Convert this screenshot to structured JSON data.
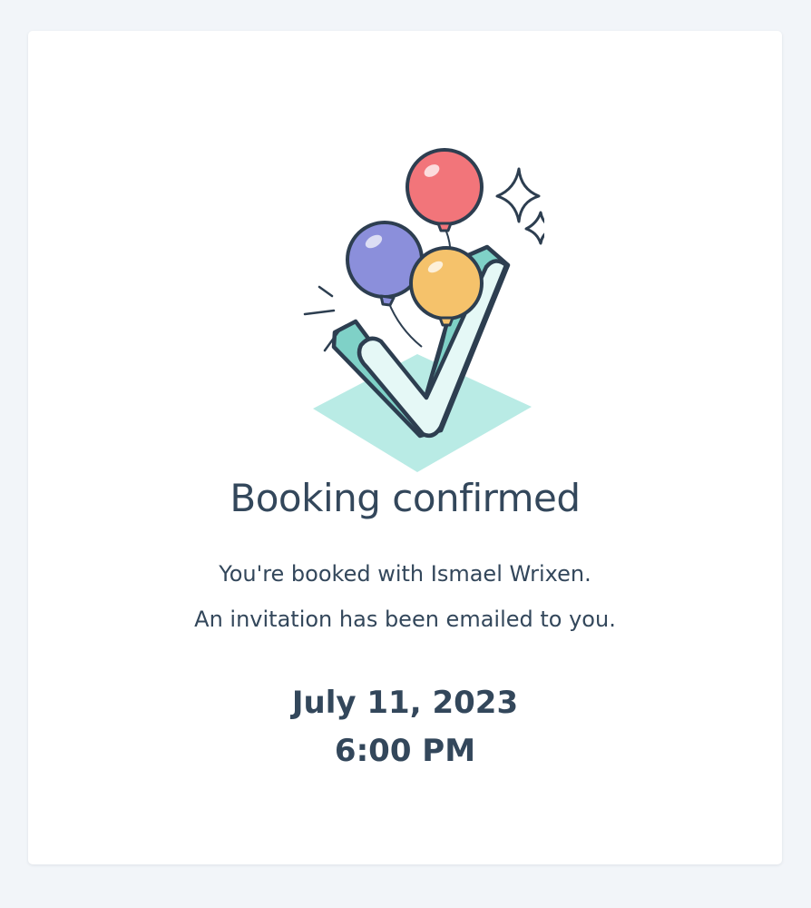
{
  "confirmation": {
    "title": "Booking confirmed",
    "line1": "You're booked with Ismael Wrixen.",
    "line2": "An invitation has been emailed to you.",
    "date": "July 11, 2023",
    "time": "6:00 PM"
  },
  "illustration": {
    "icon": "booking-confirmed-checkmark-balloons-icon",
    "colors": {
      "outline": "#2d3e50",
      "check_face": "#e5f8f6",
      "check_side": "#7fd1c7",
      "shadow": "#b9ebe5",
      "balloon_red": "#f2757a",
      "balloon_purple": "#8b8fdb",
      "balloon_yellow": "#f5c26b"
    }
  },
  "theme": {
    "page_bg": "#f2f5f9",
    "card_bg": "#ffffff",
    "text": "#33475b"
  }
}
